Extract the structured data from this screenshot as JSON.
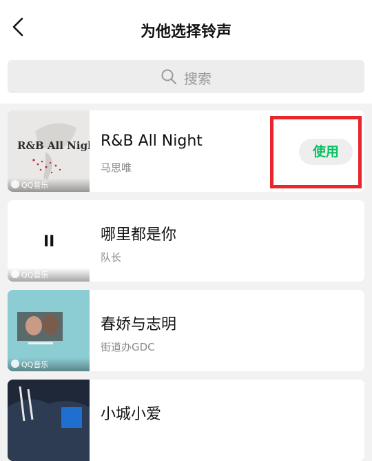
{
  "header": {
    "title": "为他选择铃声"
  },
  "search": {
    "placeholder": "搜索"
  },
  "source_label": "QQ音乐",
  "songs": [
    {
      "title": "R&B All Night",
      "artist": "马思唯",
      "cover_text": "R&B All Night",
      "action": "使用"
    },
    {
      "title": "哪里都是你",
      "artist": "队长",
      "state": "playing",
      "pause_glyph": "II"
    },
    {
      "title": "春娇与志明",
      "artist": "街道办GDC"
    },
    {
      "title": "小城小爱"
    }
  ],
  "colors": {
    "accent": "#07c160",
    "highlight": "#e8262b"
  }
}
